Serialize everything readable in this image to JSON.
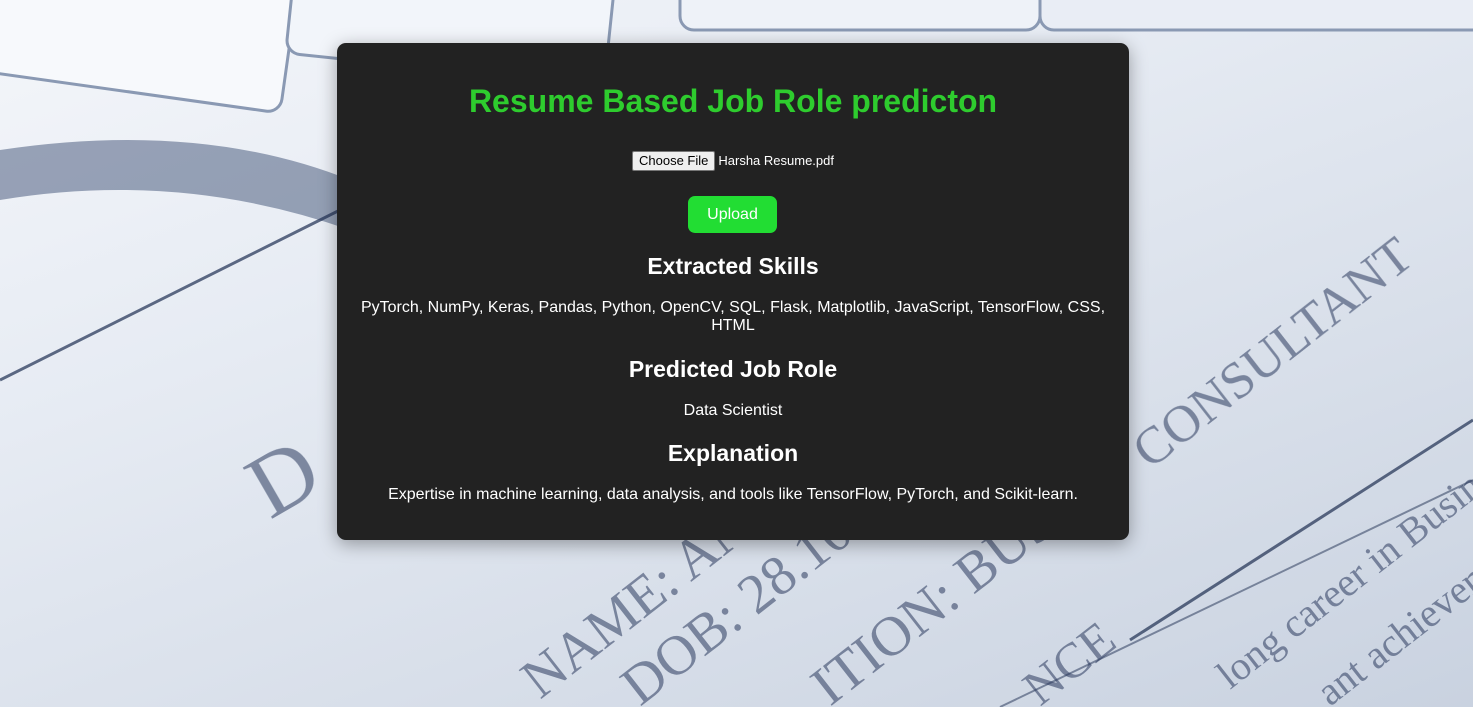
{
  "page": {
    "title": "Resume Based Job Role predicton"
  },
  "upload_form": {
    "choose_file_label": "Choose File",
    "selected_file": "Harsha Resume.pdf",
    "upload_label": "Upload"
  },
  "results": {
    "skills_heading": "Extracted Skills",
    "skills_text": "PyTorch, NumPy, Keras, Pandas, Python, OpenCV, SQL, Flask, Matplotlib, JavaScript, TensorFlow, CSS, HTML",
    "role_heading": "Predicted Job Role",
    "role_text": "Data Scientist",
    "explanation_heading": "Explanation",
    "explanation_text": "Expertise in machine learning, data analysis, and tools like TensorFlow, PyTorch, and Scikit-learn."
  },
  "colors": {
    "card_background": "#222222",
    "title_green": "#2ecc2e",
    "button_green": "#22dd33",
    "text": "#ffffff"
  }
}
